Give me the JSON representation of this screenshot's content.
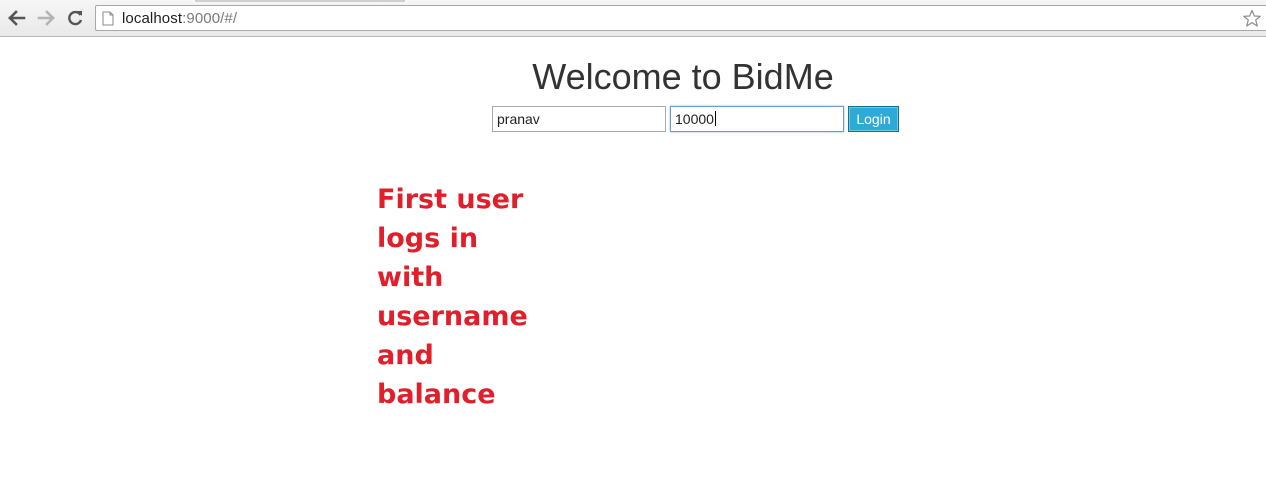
{
  "browser": {
    "url_host": "localhost",
    "url_path": ":9000/#/"
  },
  "page": {
    "title": "Welcome to BidMe"
  },
  "login": {
    "username_value": "pranav",
    "balance_value": "10000",
    "button_label": "Login"
  },
  "annotation": {
    "text": "First user\nlogs in\nwith\nusername\nand\nbalance",
    "color": "#e01f2b"
  },
  "colors": {
    "login_button": "#2eaad6",
    "title_text": "#333333"
  }
}
